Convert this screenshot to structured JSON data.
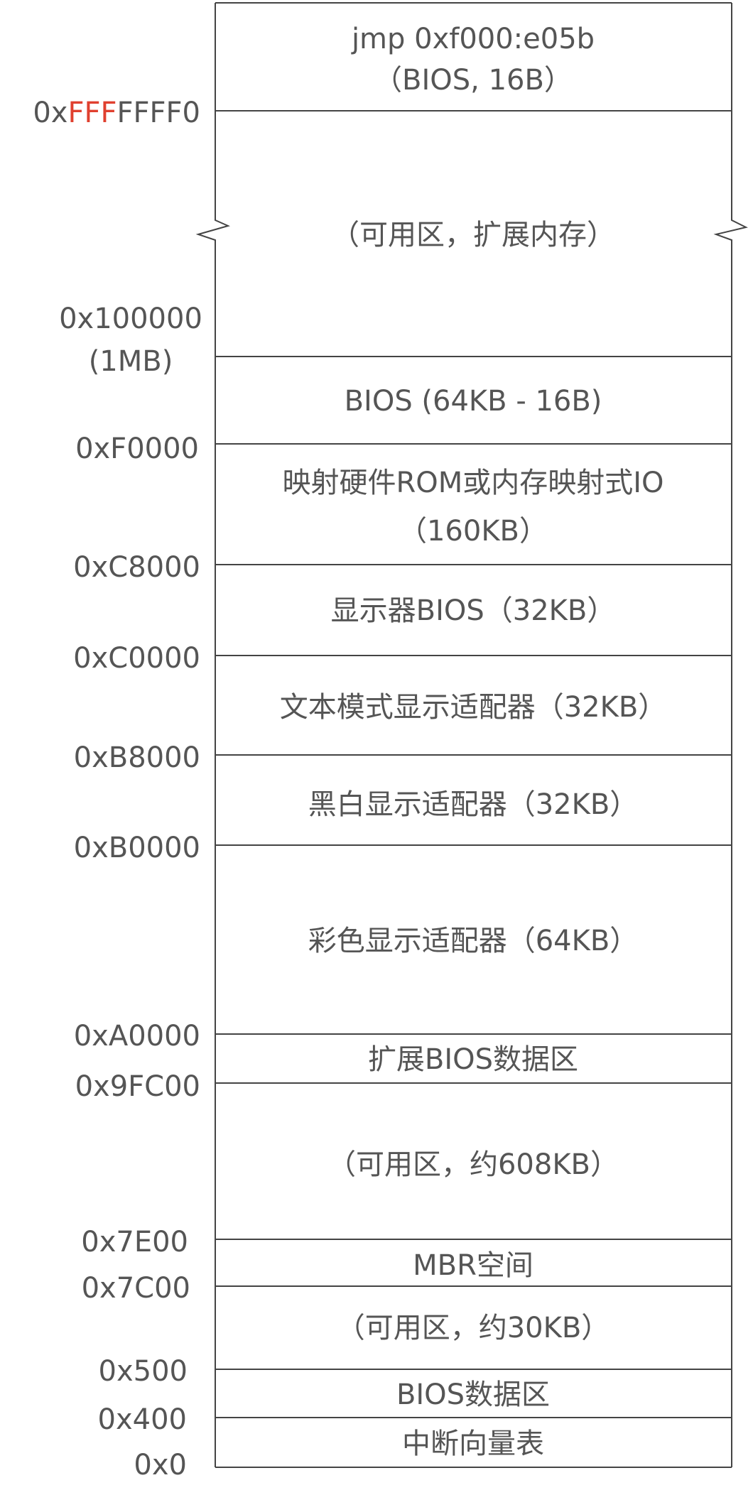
{
  "colors": {
    "text": "#555555",
    "line": "#444444",
    "accent": "#e0402f",
    "background": "#ffffff"
  },
  "regions": [
    {
      "name": "region-reset-jump",
      "lines": [
        "jmp 0xf000:e05b",
        "（BIOS, 16B）"
      ]
    },
    {
      "name": "region-extended-memory",
      "lines": [
        "（可用区，扩展内存）"
      ]
    },
    {
      "name": "region-bios",
      "lines": [
        "BIOS (64KB - 16B)"
      ]
    },
    {
      "name": "region-mapped-rom-io",
      "lines": [
        "映射硬件ROM或内存映射式IO",
        "（160KB）"
      ]
    },
    {
      "name": "region-video-bios",
      "lines": [
        "显示器BIOS（32KB）"
      ]
    },
    {
      "name": "region-text-mode-adapter",
      "lines": [
        "文本模式显示适配器（32KB）"
      ]
    },
    {
      "name": "region-mono-adapter",
      "lines": [
        "黑白显示适配器（32KB）"
      ]
    },
    {
      "name": "region-color-adapter",
      "lines": [
        "彩色显示适配器（64KB）"
      ]
    },
    {
      "name": "region-ebda",
      "lines": [
        "扩展BIOS数据区"
      ]
    },
    {
      "name": "region-free-608kb",
      "lines": [
        "（可用区，约608KB）"
      ]
    },
    {
      "name": "region-mbr",
      "lines": [
        "MBR空间"
      ]
    },
    {
      "name": "region-free-30kb",
      "lines": [
        "（可用区，约30KB）"
      ]
    },
    {
      "name": "region-bios-data",
      "lines": [
        "BIOS数据区"
      ]
    },
    {
      "name": "region-ivt",
      "lines": [
        "中断向量表"
      ]
    }
  ],
  "addresses": [
    {
      "name": "addr-0xfffffff0",
      "parts": [
        {
          "text": "0x",
          "accent": false
        },
        {
          "text": "FFF",
          "accent": true
        },
        {
          "text": "FFFF0",
          "accent": false
        }
      ]
    },
    {
      "name": "addr-0x100000",
      "lines": [
        "0x100000",
        "(1MB)"
      ]
    },
    {
      "name": "addr-0xf0000",
      "lines": [
        "0xF0000"
      ]
    },
    {
      "name": "addr-0xc8000",
      "lines": [
        "0xC8000"
      ]
    },
    {
      "name": "addr-0xc0000",
      "lines": [
        "0xC0000"
      ]
    },
    {
      "name": "addr-0xb8000",
      "lines": [
        "0xB8000"
      ]
    },
    {
      "name": "addr-0xb0000",
      "lines": [
        "0xB0000"
      ]
    },
    {
      "name": "addr-0xa0000",
      "lines": [
        "0xA0000"
      ]
    },
    {
      "name": "addr-0x9fc00",
      "lines": [
        "0x9FC00"
      ]
    },
    {
      "name": "addr-0x7e00",
      "lines": [
        "0x7E00"
      ]
    },
    {
      "name": "addr-0x7c00",
      "lines": [
        "0x7C00"
      ]
    },
    {
      "name": "addr-0x500",
      "lines": [
        "0x500"
      ]
    },
    {
      "name": "addr-0x400",
      "lines": [
        "0x400"
      ]
    },
    {
      "name": "addr-0x0",
      "lines": [
        "0x0"
      ]
    }
  ]
}
